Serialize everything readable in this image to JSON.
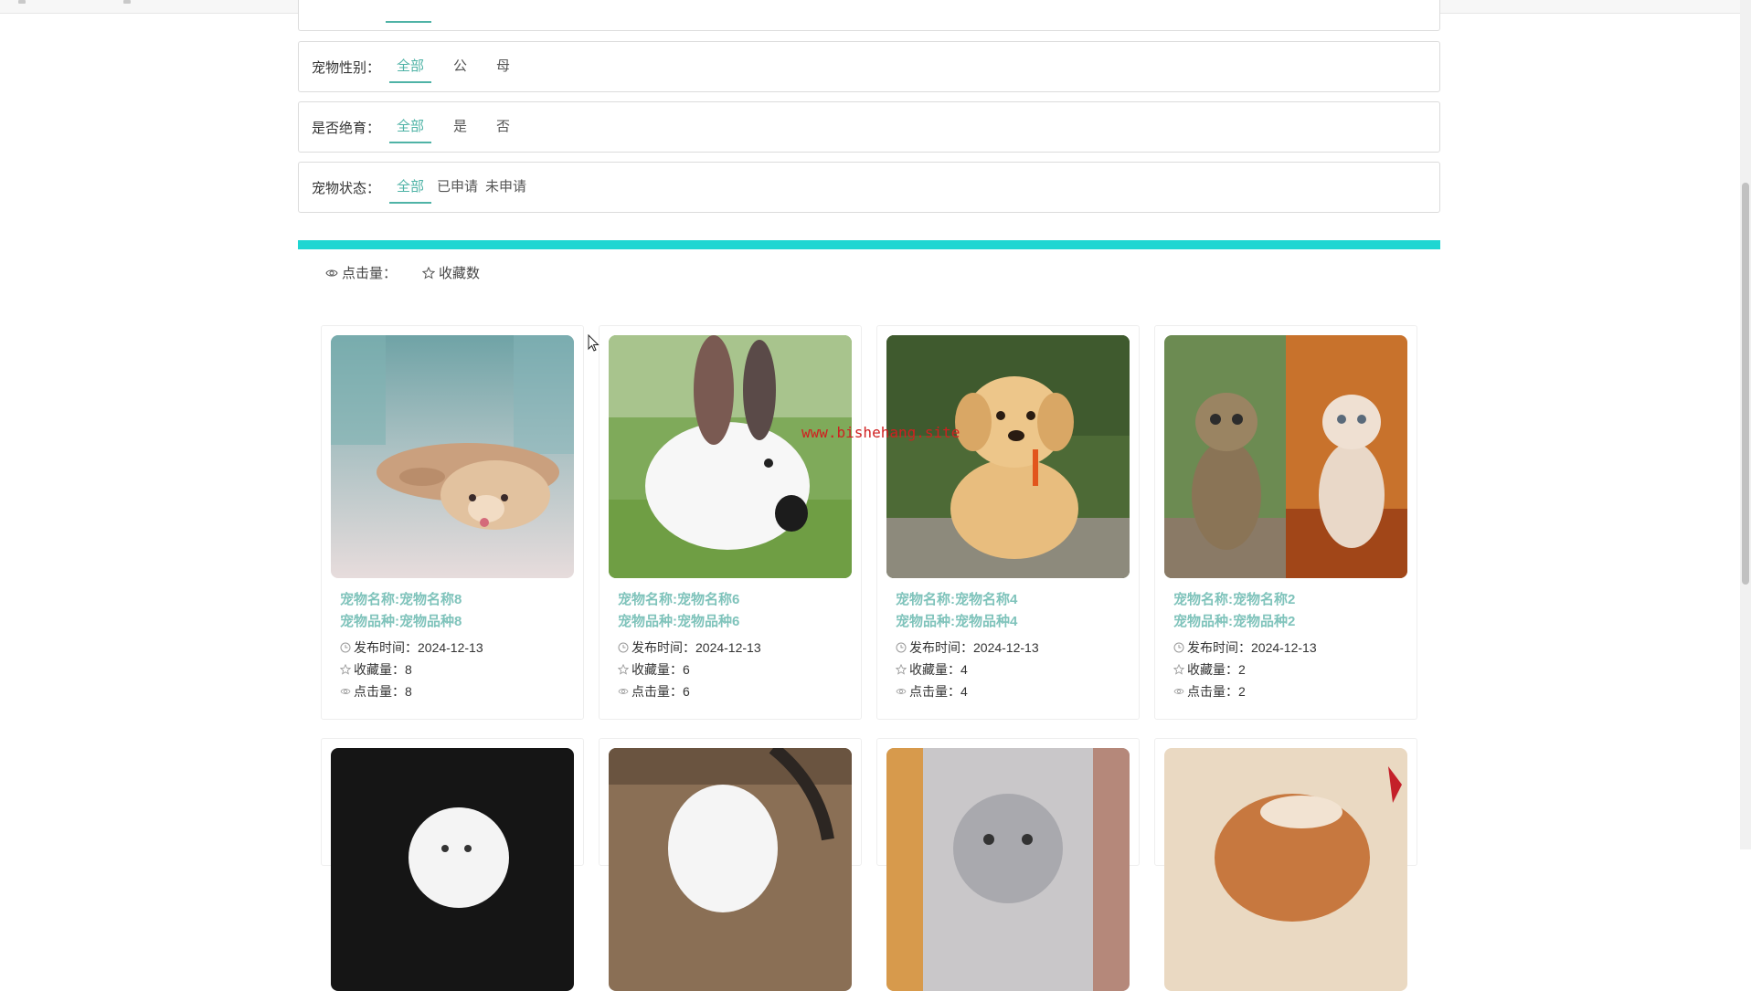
{
  "filters": {
    "gender": {
      "label": "宠物性别：",
      "options": [
        "全部",
        "公",
        "母"
      ]
    },
    "neutered": {
      "label": "是否绝育：",
      "options": [
        "全部",
        "是",
        "否"
      ]
    },
    "status": {
      "label": "宠物状态：",
      "options": [
        "全部",
        "已申请",
        "未申请"
      ]
    }
  },
  "sort": {
    "clicks": "点击量：",
    "favorites": "收藏数"
  },
  "watermark": "www.bishehang.site",
  "cards": [
    {
      "name": "宠物名称:宠物名称8",
      "breed": "宠物品种:宠物品种8",
      "published": "发布时间：2024-12-13",
      "favorites": "收藏量：8",
      "clicks": "点击量：8"
    },
    {
      "name": "宠物名称:宠物名称6",
      "breed": "宠物品种:宠物品种6",
      "published": "发布时间：2024-12-13",
      "favorites": "收藏量：6",
      "clicks": "点击量：6"
    },
    {
      "name": "宠物名称:宠物名称4",
      "breed": "宠物品种:宠物品种4",
      "published": "发布时间：2024-12-13",
      "favorites": "收藏量：4",
      "clicks": "点击量：4"
    },
    {
      "name": "宠物名称:宠物名称2",
      "breed": "宠物品种:宠物品种2",
      "published": "发布时间：2024-12-13",
      "favorites": "收藏量：2",
      "clicks": "点击量：2"
    }
  ],
  "colors": {
    "accent": "#4fb3a6",
    "bar": "#1fd6d2",
    "title": "#7fc3bb",
    "watermark": "#d02020"
  },
  "icons": {
    "eye": "eye-icon",
    "star": "star-icon",
    "clock": "clock-icon"
  }
}
